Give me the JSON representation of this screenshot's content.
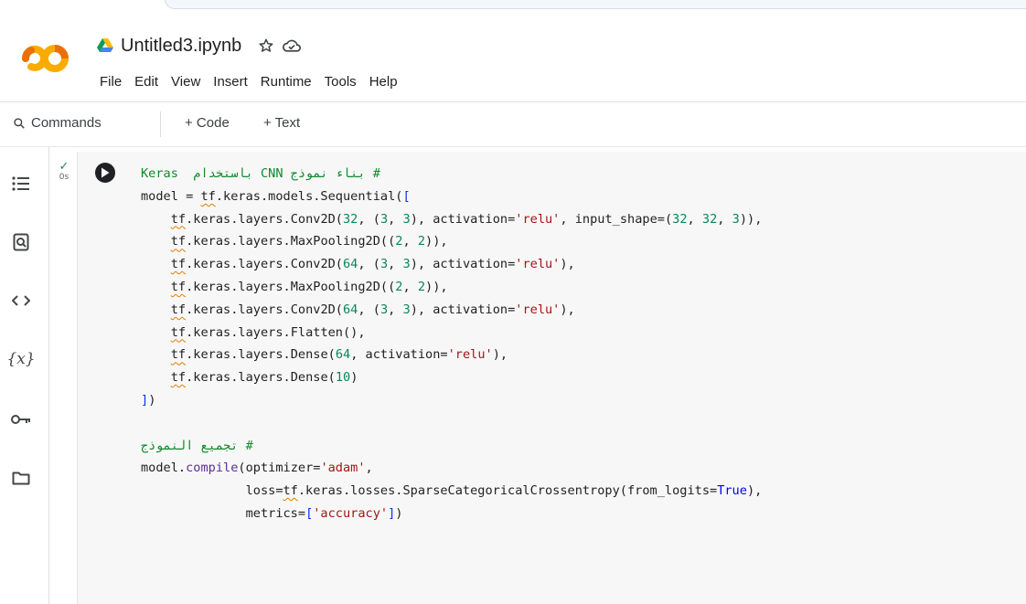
{
  "notebook": {
    "title": "Untitled3.ipynb"
  },
  "menu": [
    "File",
    "Edit",
    "View",
    "Insert",
    "Runtime",
    "Tools",
    "Help"
  ],
  "toolbar": {
    "commands_label": "Commands",
    "add_code_label": "+ Code",
    "add_text_label": "+ Text"
  },
  "sidebar_icons": [
    "table-of-contents-icon",
    "find-replace-icon",
    "code-snippets-icon",
    "variables-icon",
    "secrets-key-icon",
    "files-folder-icon"
  ],
  "cell": {
    "status_check": "✓",
    "exec_time": "0s",
    "code_lines": [
      [
        {
          "t": "# بناء نموذج CNN باستخدام  Keras",
          "c": "c-cmt"
        }
      ],
      [
        {
          "t": "model = "
        },
        {
          "t": "tf",
          "c": "c-tf"
        },
        {
          "t": ".keras.models.Sequential("
        },
        {
          "t": "[",
          "c": "c-br"
        }
      ],
      [
        {
          "t": "    "
        },
        {
          "t": "tf",
          "c": "c-tf"
        },
        {
          "t": ".keras.layers.Conv2D("
        },
        {
          "t": "32",
          "c": "c-num"
        },
        {
          "t": ", ("
        },
        {
          "t": "3",
          "c": "c-num"
        },
        {
          "t": ", "
        },
        {
          "t": "3",
          "c": "c-num"
        },
        {
          "t": "), activation="
        },
        {
          "t": "'relu'",
          "c": "c-str"
        },
        {
          "t": ", input_shape=("
        },
        {
          "t": "32",
          "c": "c-num"
        },
        {
          "t": ", "
        },
        {
          "t": "32",
          "c": "c-num"
        },
        {
          "t": ", "
        },
        {
          "t": "3",
          "c": "c-num"
        },
        {
          "t": ")),"
        }
      ],
      [
        {
          "t": "    "
        },
        {
          "t": "tf",
          "c": "c-tf"
        },
        {
          "t": ".keras.layers.MaxPooling2D(("
        },
        {
          "t": "2",
          "c": "c-num"
        },
        {
          "t": ", "
        },
        {
          "t": "2",
          "c": "c-num"
        },
        {
          "t": ")),"
        }
      ],
      [
        {
          "t": "    "
        },
        {
          "t": "tf",
          "c": "c-tf"
        },
        {
          "t": ".keras.layers.Conv2D("
        },
        {
          "t": "64",
          "c": "c-num"
        },
        {
          "t": ", ("
        },
        {
          "t": "3",
          "c": "c-num"
        },
        {
          "t": ", "
        },
        {
          "t": "3",
          "c": "c-num"
        },
        {
          "t": "), activation="
        },
        {
          "t": "'relu'",
          "c": "c-str"
        },
        {
          "t": "),"
        }
      ],
      [
        {
          "t": "    "
        },
        {
          "t": "tf",
          "c": "c-tf"
        },
        {
          "t": ".keras.layers.MaxPooling2D(("
        },
        {
          "t": "2",
          "c": "c-num"
        },
        {
          "t": ", "
        },
        {
          "t": "2",
          "c": "c-num"
        },
        {
          "t": ")),"
        }
      ],
      [
        {
          "t": "    "
        },
        {
          "t": "tf",
          "c": "c-tf"
        },
        {
          "t": ".keras.layers.Conv2D("
        },
        {
          "t": "64",
          "c": "c-num"
        },
        {
          "t": ", ("
        },
        {
          "t": "3",
          "c": "c-num"
        },
        {
          "t": ", "
        },
        {
          "t": "3",
          "c": "c-num"
        },
        {
          "t": "), activation="
        },
        {
          "t": "'relu'",
          "c": "c-str"
        },
        {
          "t": "),"
        }
      ],
      [
        {
          "t": "    "
        },
        {
          "t": "tf",
          "c": "c-tf"
        },
        {
          "t": ".keras.layers.Flatten(),"
        }
      ],
      [
        {
          "t": "    "
        },
        {
          "t": "tf",
          "c": "c-tf"
        },
        {
          "t": ".keras.layers.Dense("
        },
        {
          "t": "64",
          "c": "c-num"
        },
        {
          "t": ", activation="
        },
        {
          "t": "'relu'",
          "c": "c-str"
        },
        {
          "t": "),"
        }
      ],
      [
        {
          "t": "    "
        },
        {
          "t": "tf",
          "c": "c-tf"
        },
        {
          "t": ".keras.layers.Dense("
        },
        {
          "t": "10",
          "c": "c-num"
        },
        {
          "t": ")"
        }
      ],
      [
        {
          "t": "]",
          "c": "c-br"
        },
        {
          "t": ")"
        }
      ],
      [
        {
          "t": ""
        }
      ],
      [
        {
          "t": "# تجميع النموذج",
          "c": "c-cmt"
        }
      ],
      [
        {
          "t": "model."
        },
        {
          "t": "compile",
          "c": "c-fn"
        },
        {
          "t": "(optimizer="
        },
        {
          "t": "'adam'",
          "c": "c-str"
        },
        {
          "t": ","
        }
      ],
      [
        {
          "t": "              loss="
        },
        {
          "t": "tf",
          "c": "c-tf"
        },
        {
          "t": ".keras.losses.SparseCategoricalCrossentropy(from_logits="
        },
        {
          "t": "True",
          "c": "c-kw"
        },
        {
          "t": "),"
        }
      ],
      [
        {
          "t": "              metrics="
        },
        {
          "t": "[",
          "c": "c-br"
        },
        {
          "t": "'accuracy'",
          "c": "c-str"
        },
        {
          "t": "]",
          "c": "c-br"
        },
        {
          "t": ")"
        }
      ]
    ]
  },
  "colors": {
    "comment": "#0f8a2a",
    "string": "#a31515",
    "number": "#098658",
    "keyword": "#0000ff",
    "colab_orange": "#f9ab00",
    "colab_dark_orange": "#e8710a"
  }
}
